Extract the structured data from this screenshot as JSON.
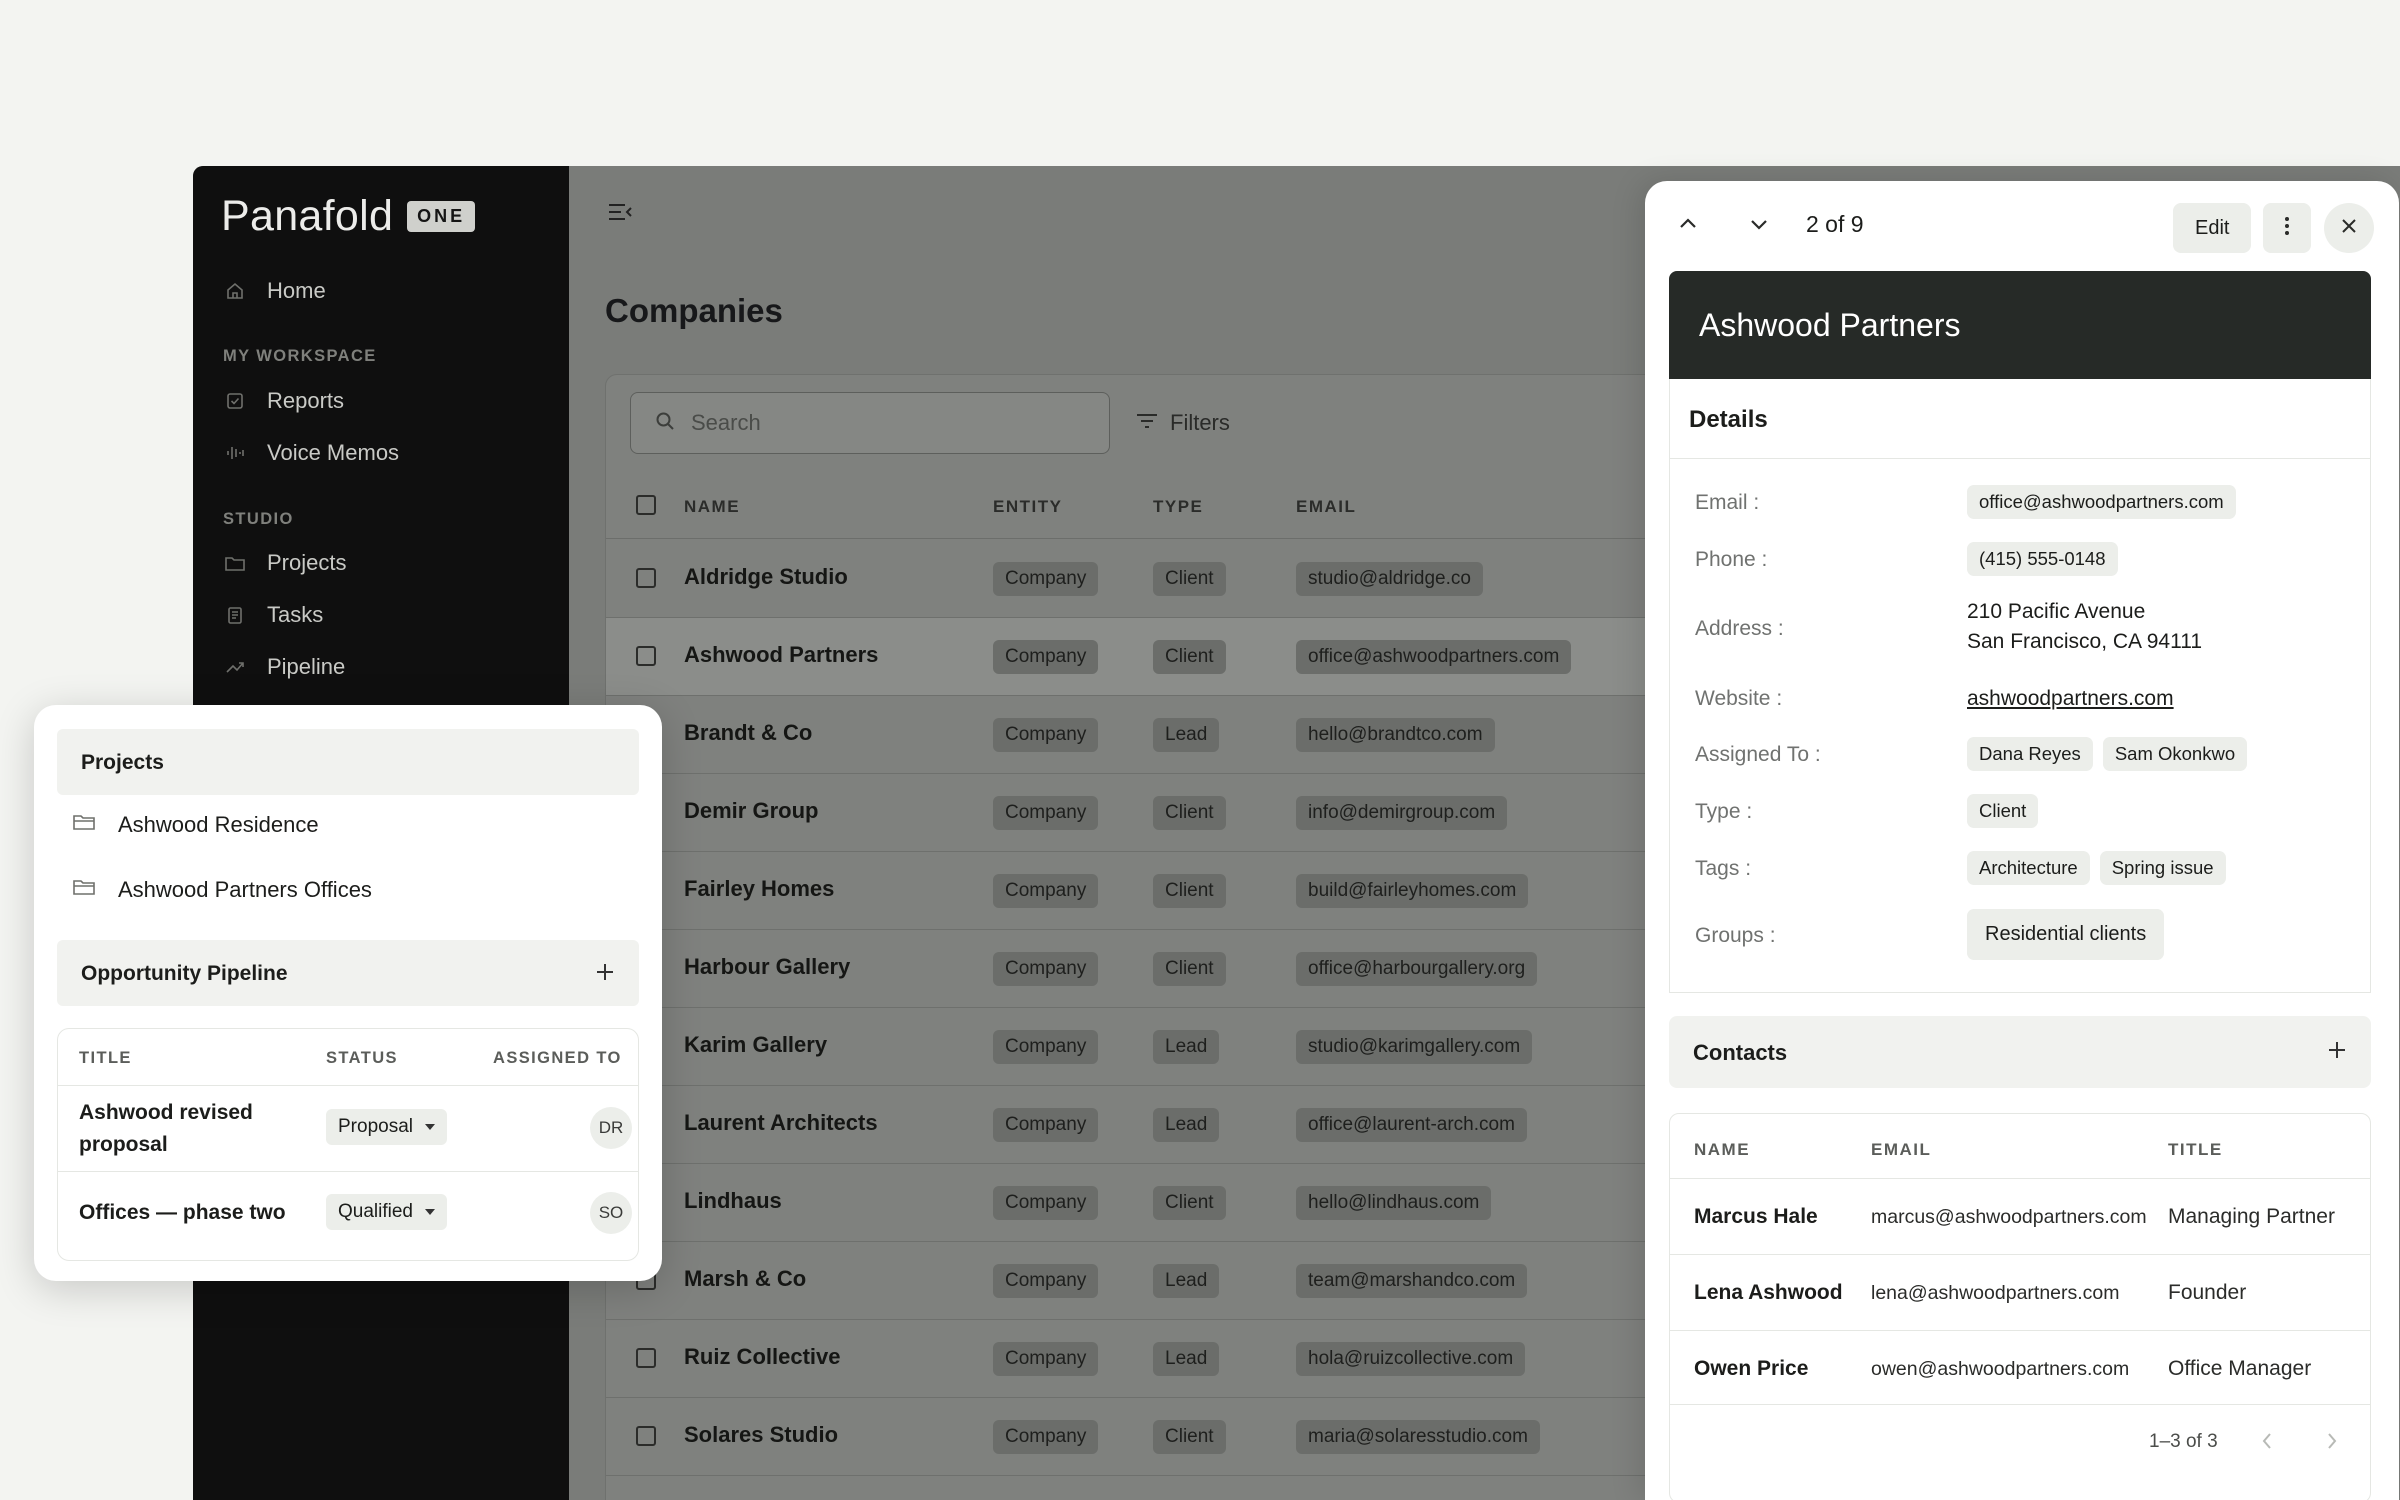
{
  "sidebar": {
    "logo": "Panafold",
    "logo_badge": "ONE",
    "home": "Home",
    "section_workspace": "MY WORKSPACE",
    "reports": "Reports",
    "voice_memos": "Voice Memos",
    "section_studio": "STUDIO",
    "projects": "Projects",
    "tasks": "Tasks",
    "pipeline": "Pipeline"
  },
  "main": {
    "title": "Companies",
    "search_placeholder": "Search",
    "filters_label": "Filters",
    "columns": [
      "NAME",
      "ENTITY",
      "TYPE",
      "EMAIL"
    ],
    "rows": [
      {
        "name": "Aldridge Studio",
        "entity": "Company",
        "type": "Client",
        "email": "studio@aldridge.co"
      },
      {
        "name": "Ashwood Partners",
        "entity": "Company",
        "type": "Client",
        "email": "office@ashwoodpartners.com"
      },
      {
        "name": "Brandt & Co",
        "entity": "Company",
        "type": "Lead",
        "email": "hello@brandtco.com"
      },
      {
        "name": "Demir Group",
        "entity": "Company",
        "type": "Client",
        "email": "info@demirgroup.com"
      },
      {
        "name": "Fairley Homes",
        "entity": "Company",
        "type": "Client",
        "email": "build@fairleyhomes.com"
      },
      {
        "name": "Harbour Gallery",
        "entity": "Company",
        "type": "Client",
        "email": "office@harbourgallery.org"
      },
      {
        "name": "Karim Gallery",
        "entity": "Company",
        "type": "Lead",
        "email": "studio@karimgallery.com"
      },
      {
        "name": "Laurent Architects",
        "entity": "Company",
        "type": "Lead",
        "email": "office@laurent-arch.com"
      },
      {
        "name": "Lindhaus",
        "entity": "Company",
        "type": "Client",
        "email": "hello@lindhaus.com"
      },
      {
        "name": "Marsh & Co",
        "entity": "Company",
        "type": "Lead",
        "email": "team@marshandco.com"
      },
      {
        "name": "Ruiz Collective",
        "entity": "Company",
        "type": "Lead",
        "email": "hola@ruizcollective.com"
      },
      {
        "name": "Solares Studio",
        "entity": "Company",
        "type": "Client",
        "email": "maria@solaresstudio.com"
      }
    ]
  },
  "panel": {
    "counter": "2 of 9",
    "edit_label": "Edit",
    "company_name": "Ashwood Partners",
    "details_title": "Details",
    "email_label": "Email :",
    "email": "office@ashwoodpartners.com",
    "phone_label": "Phone :",
    "phone": "(415) 555-0148",
    "address_label": "Address :",
    "address_line1": "210 Pacific Avenue",
    "address_line2": "San Francisco, CA 94111",
    "website_label": "Website :",
    "website": "ashwoodpartners.com",
    "assigned_label": "Assigned To :",
    "assigned": [
      "Dana Reyes",
      "Sam Okonkwo"
    ],
    "type_label": "Type :",
    "type": "Client",
    "tags_label": "Tags :",
    "tags": [
      "Architecture",
      "Spring issue"
    ],
    "groups_label": "Groups :",
    "groups": "Residential clients",
    "contacts_title": "Contacts",
    "contact_columns": [
      "NAME",
      "EMAIL",
      "TITLE"
    ],
    "contacts": [
      {
        "name": "Marcus Hale",
        "email": "marcus@ashwoodpartners.com",
        "title": "Managing Partner"
      },
      {
        "name": "Lena Ashwood",
        "email": "lena@ashwoodpartners.com",
        "title": "Founder"
      },
      {
        "name": "Owen Price",
        "email": "owen@ashwoodpartners.com",
        "title": "Office Manager"
      }
    ],
    "contacts_range": "1–3 of 3"
  },
  "popup": {
    "projects_title": "Projects",
    "projects": [
      "Ashwood Residence",
      "Ashwood Partners Offices"
    ],
    "pipeline_title": "Opportunity Pipeline",
    "columns": [
      "TITLE",
      "STATUS",
      "ASSIGNED TO"
    ],
    "opportunities": [
      {
        "title_line1": "Ashwood revised",
        "title_line2": "proposal",
        "status": "Proposal",
        "assignee": "DR"
      },
      {
        "title_line1": "Offices — phase two",
        "title_line2": "",
        "status": "Qualified",
        "assignee": "SO"
      }
    ]
  }
}
